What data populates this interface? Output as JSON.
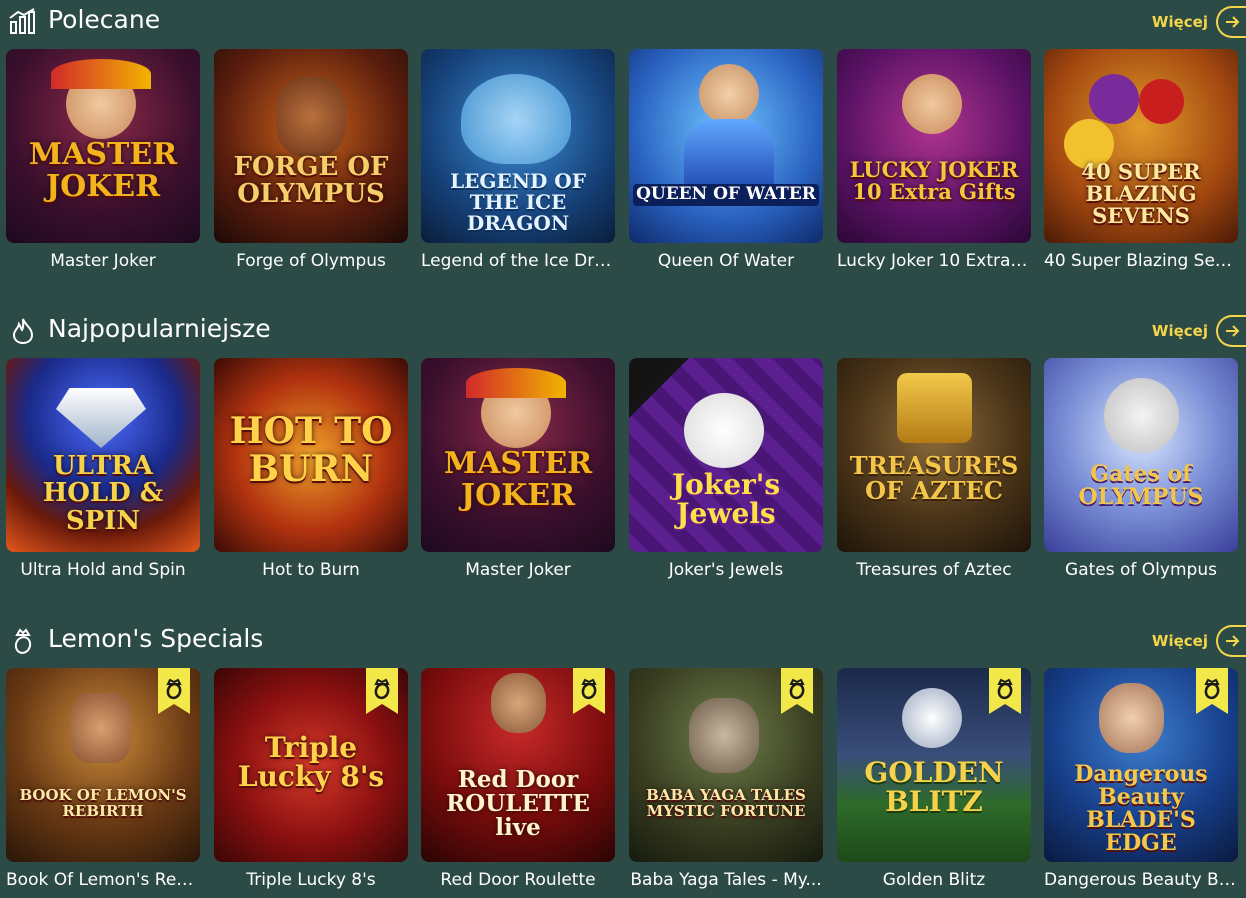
{
  "colors": {
    "background": "#2c4a46",
    "accent": "#f3d64a"
  },
  "sections": [
    {
      "title": "Polecane",
      "icon": "chart-bars-icon",
      "more": "Więcej",
      "games": [
        {
          "name": "Master Joker",
          "art": "MASTER JOKER"
        },
        {
          "name": "Forge of Olympus",
          "art": "FORGE OF OLYMPUS"
        },
        {
          "name": "Legend of the Ice Dra...",
          "art": "LEGEND OF THE ICE DRAGON"
        },
        {
          "name": "Queen Of Water",
          "art": "QUEEN OF WATER"
        },
        {
          "name": "Lucky Joker 10 Extra ...",
          "art": "LUCKY JOKER 10 Extra Gifts"
        },
        {
          "name": "40 Super Blazing Sev...",
          "art": "40 SUPER BLAZING SEVENS"
        }
      ]
    },
    {
      "title": "Najpopularniejsze",
      "icon": "flame-icon",
      "more": "Więcej",
      "games": [
        {
          "name": "Ultra Hold and Spin",
          "art": "ULTRA HOLD & SPIN"
        },
        {
          "name": "Hot to Burn",
          "art": "HOT TO BURN"
        },
        {
          "name": "Master Joker",
          "art": "MASTER JOKER"
        },
        {
          "name": "Joker's Jewels",
          "art": "Joker's Jewels"
        },
        {
          "name": "Treasures of Aztec",
          "art": "TREASURES OF AZTEC"
        },
        {
          "name": "Gates of Olympus",
          "art": "Gates of OLYMPUS"
        }
      ]
    },
    {
      "title": "Lemon's Specials",
      "icon": "lemon-crown-icon",
      "more": "Więcej",
      "games": [
        {
          "name": "Book Of Lemon's Reb...",
          "art": "BOOK OF LEMON'S REBIRTH"
        },
        {
          "name": "Triple Lucky 8's",
          "art": "Triple Lucky 8's"
        },
        {
          "name": "Red Door Roulette",
          "art": "Red Door ROULETTE live"
        },
        {
          "name": "Baba Yaga Tales - My...",
          "art": "BABA YAGA TALES MYSTIC FORTUNE"
        },
        {
          "name": "Golden Blitz",
          "art": "GOLDEN BLITZ"
        },
        {
          "name": "Dangerous Beauty Bl...",
          "art": "Dangerous Beauty BLADE'S EDGE"
        }
      ]
    }
  ]
}
